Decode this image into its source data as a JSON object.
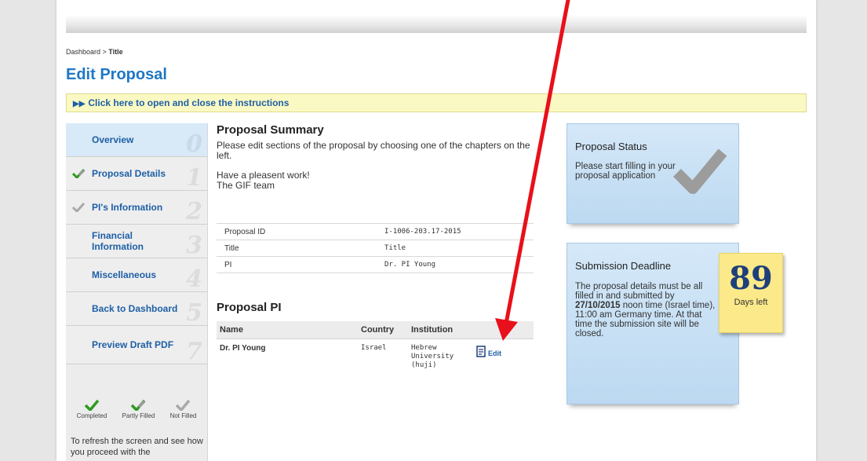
{
  "breadcrumb": {
    "parent": "Dashboard",
    "separator": " > ",
    "current": "Title"
  },
  "page_title": "Edit Proposal",
  "instructions_toggle": "Click here to open and close the instructions",
  "sidebar": {
    "items": [
      {
        "label": "Overview",
        "number": "0",
        "state": "none"
      },
      {
        "label": "Proposal Details",
        "number": "1",
        "state": "partial"
      },
      {
        "label": "PI's Information",
        "number": "2",
        "state": "not-filled"
      },
      {
        "label": "Financial Information",
        "number": "3",
        "state": "none"
      },
      {
        "label": "Miscellaneous",
        "number": "4",
        "state": "none"
      },
      {
        "label": "Back to Dashboard",
        "number": "5",
        "state": "none"
      },
      {
        "label": "Preview Draft PDF",
        "number": "7",
        "state": "none"
      }
    ],
    "legend": {
      "completed": "Completed",
      "partly": "Partly Filled",
      "not_filled": "Not Filled"
    },
    "refresh_text": "To refresh the screen and see how you proceed with the"
  },
  "summary": {
    "title": "Proposal Summary",
    "intro": "Please edit sections of the proposal by choosing one of the chapters on the left.",
    "greeting_line1": "Have a pleasent work!",
    "greeting_line2": "The GIF team",
    "rows": [
      {
        "label": "Proposal ID",
        "value": "I-1006-203.17-2015"
      },
      {
        "label": "Title",
        "value": "Title"
      },
      {
        "label": "PI",
        "value": "Dr. PI Young"
      }
    ]
  },
  "pi": {
    "title": "Proposal PI",
    "headers": {
      "name": "Name",
      "country": "Country",
      "institution": "Institution"
    },
    "row": {
      "name": "Dr. PI Young",
      "country": "Israel",
      "institution": "Hebrew University (huji)",
      "edit": "Edit"
    }
  },
  "status_panel": {
    "title": "Proposal Status",
    "text": "Please start filling in your proposal application"
  },
  "deadline_panel": {
    "title": "Submission Deadline",
    "days": "89",
    "days_label": "Days left",
    "text_before": "The proposal details must be all filled in and submitted by",
    "date": "27/10/2015",
    "text_after": " noon time (Israel time), 11:00 am Germany time. At that time the submission site will be closed."
  },
  "colors": {
    "accent": "#1f77c4",
    "link": "#1e5fa6",
    "check_green": "#2e9a1f",
    "arrow": "#e8101a"
  },
  "icons": {
    "completed": "green-check-icon",
    "partial": "partial-check-icon",
    "not_filled": "gray-check-icon",
    "edit": "document-edit-icon"
  }
}
